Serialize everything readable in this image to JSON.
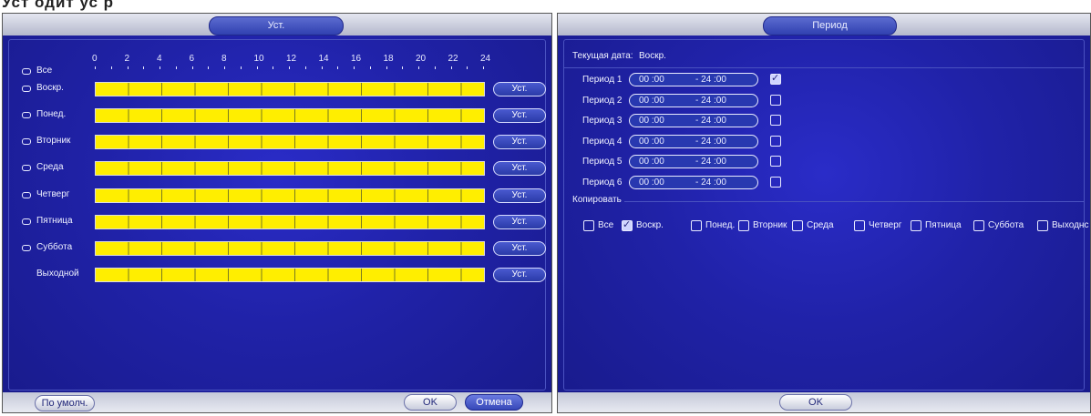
{
  "top_caption": "Уст     одит                    ус     р",
  "schedule": {
    "title": "Уст.",
    "ruler_labels": [
      "0",
      "2",
      "4",
      "6",
      "8",
      "10",
      "12",
      "14",
      "16",
      "18",
      "20",
      "22",
      "24"
    ],
    "rows": [
      {
        "label": "Все",
        "has_bar": false
      },
      {
        "label": "Воскр.",
        "has_bar": true,
        "button": "Уст."
      },
      {
        "label": "Понед.",
        "has_bar": true,
        "button": "Уст."
      },
      {
        "label": "Вторник",
        "has_bar": true,
        "button": "Уст."
      },
      {
        "label": "Среда",
        "has_bar": true,
        "button": "Уст."
      },
      {
        "label": "Четверг",
        "has_bar": true,
        "button": "Уст."
      },
      {
        "label": "Пятница",
        "has_bar": true,
        "button": "Уст."
      },
      {
        "label": "Суббота",
        "has_bar": true,
        "button": "Уст."
      },
      {
        "label": "Выходной",
        "has_bar": true,
        "button": "Уст."
      }
    ],
    "default_button": "По умолч.",
    "ok_button": "OK",
    "cancel_button": "Отмена"
  },
  "period": {
    "title": "Период",
    "current_date_label": "Текущая дата:",
    "current_date_value": "Воскр.",
    "periods": [
      {
        "label": "Период 1",
        "start": "00 :00",
        "end": "- 24 :00",
        "checked": true
      },
      {
        "label": "Период 2",
        "start": "00 :00",
        "end": "- 24 :00",
        "checked": false
      },
      {
        "label": "Период 3",
        "start": "00 :00",
        "end": "- 24 :00",
        "checked": false
      },
      {
        "label": "Период 4",
        "start": "00 :00",
        "end": "- 24 :00",
        "checked": false
      },
      {
        "label": "Период 5",
        "start": "00 :00",
        "end": "- 24 :00",
        "checked": false
      },
      {
        "label": "Период 6",
        "start": "00 :00",
        "end": "- 24 :00",
        "checked": false
      }
    ],
    "copy_label": "Копировать",
    "copy_days": [
      {
        "label": "Все",
        "checked": false
      },
      {
        "label": "Воскр.",
        "checked": true
      },
      {
        "label": "Понед.",
        "checked": false
      },
      {
        "label": "Вторник",
        "checked": false
      },
      {
        "label": "Среда",
        "checked": false
      },
      {
        "label": "Четверг",
        "checked": false
      },
      {
        "label": "Пятница",
        "checked": false
      },
      {
        "label": "Суббота",
        "checked": false
      },
      {
        "label": "Выходнс",
        "checked": false
      }
    ],
    "ok_button": "OK"
  },
  "colors": {
    "panel_bg": "#2022a8",
    "timeline_fill": "#ffee00",
    "title_pill": "#4050c0"
  }
}
